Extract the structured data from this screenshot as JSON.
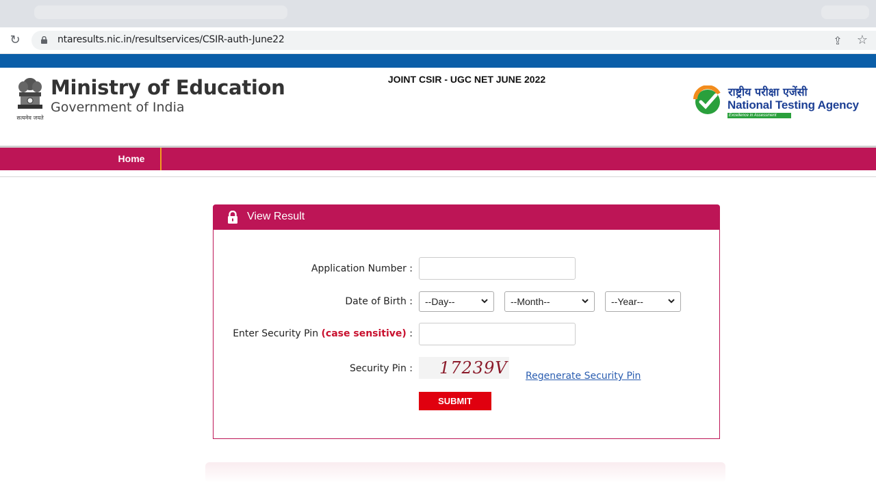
{
  "browser": {
    "url": "ntaresults.nic.in/resultservices/CSIR-auth-June22"
  },
  "header": {
    "ministry_title": "Ministry of Education",
    "ministry_subtitle": "Government of India",
    "emblem_caption": "सत्यमेव जयते",
    "exam_title": "JOINT CSIR - UGC NET JUNE 2022",
    "agency_hindi": "राष्ट्रीय परीक्षा एजेंसी",
    "agency_english": "National Testing Agency",
    "agency_tagline": "Excellence in Assessment"
  },
  "nav": {
    "home_label": "Home"
  },
  "panel": {
    "title": "View Result"
  },
  "form": {
    "application_number_label": "Application Number :",
    "application_number_value": "",
    "dob_label": "Date of Birth :",
    "day_selected": "--Day--",
    "month_selected": "--Month--",
    "year_selected": "--Year--",
    "security_pin_label": "Enter Security Pin",
    "security_pin_note": "(case sensitive)",
    "security_pin_colon": " :",
    "security_pin_value": "",
    "captcha_label": "Security Pin :",
    "captcha_text": "17239V",
    "regenerate_label": "Regenerate Security Pin",
    "submit_label": "SUBMIT"
  },
  "colors": {
    "brand_magenta": "#bd1556",
    "top_blue": "#0b5ea8",
    "submit_red": "#e0000f",
    "nta_blue": "#1c3f94",
    "nta_green": "#2aa03c"
  },
  "icons": [
    "reload-icon",
    "lock-icon",
    "share-icon",
    "star-icon",
    "padlock-icon",
    "chevron-down-icon"
  ]
}
